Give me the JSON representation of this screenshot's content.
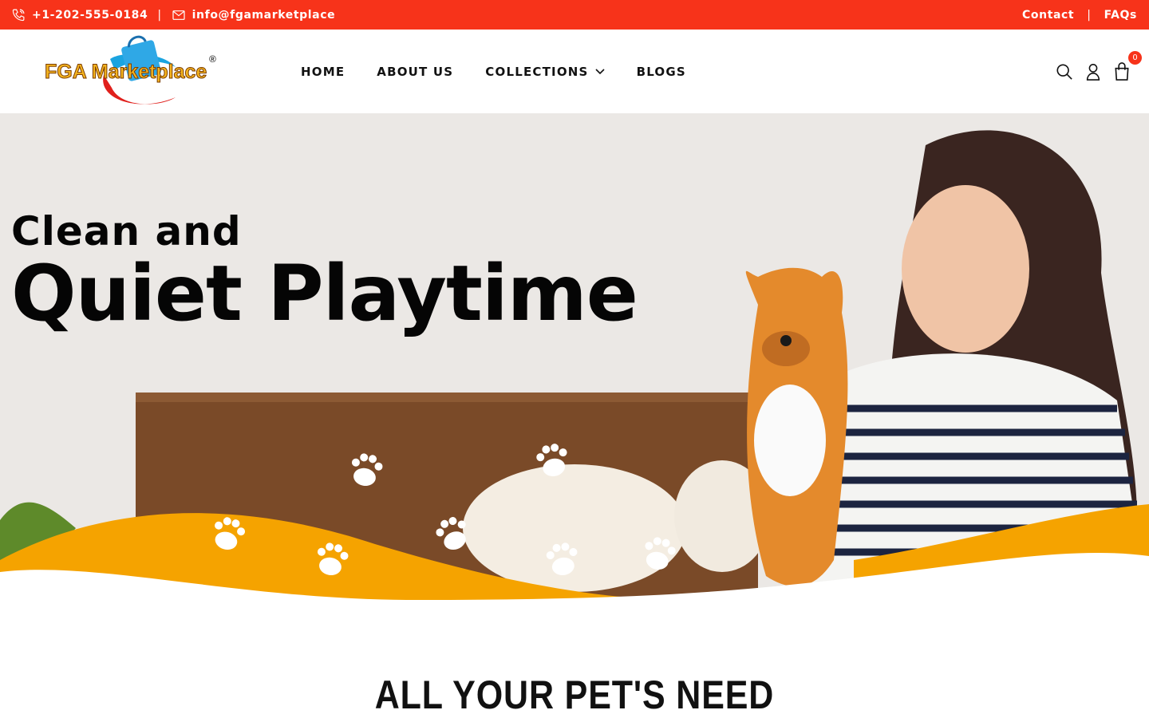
{
  "topbar": {
    "phone": "+1-202-555-0184",
    "separator": "|",
    "email": "info@fgamarketplace",
    "contact_label": "Contact",
    "faqs_label": "FAQs",
    "background_color": "#f7331a"
  },
  "header": {
    "logo_text": "FGA Marketplace",
    "logo_mark": "®",
    "nav": [
      {
        "label": "HOME"
      },
      {
        "label": "ABOUT US"
      },
      {
        "label": "COLLECTIONS"
      },
      {
        "label": "BLOGS"
      }
    ],
    "cart_count": "0",
    "icons": [
      "search-icon",
      "user-icon",
      "cart-icon"
    ]
  },
  "hero": {
    "line1": "Clean and",
    "line2": "Quiet Playtime",
    "accent_color": "#f5a300"
  },
  "section": {
    "title": "ALL YOUR PET'S NEED"
  }
}
